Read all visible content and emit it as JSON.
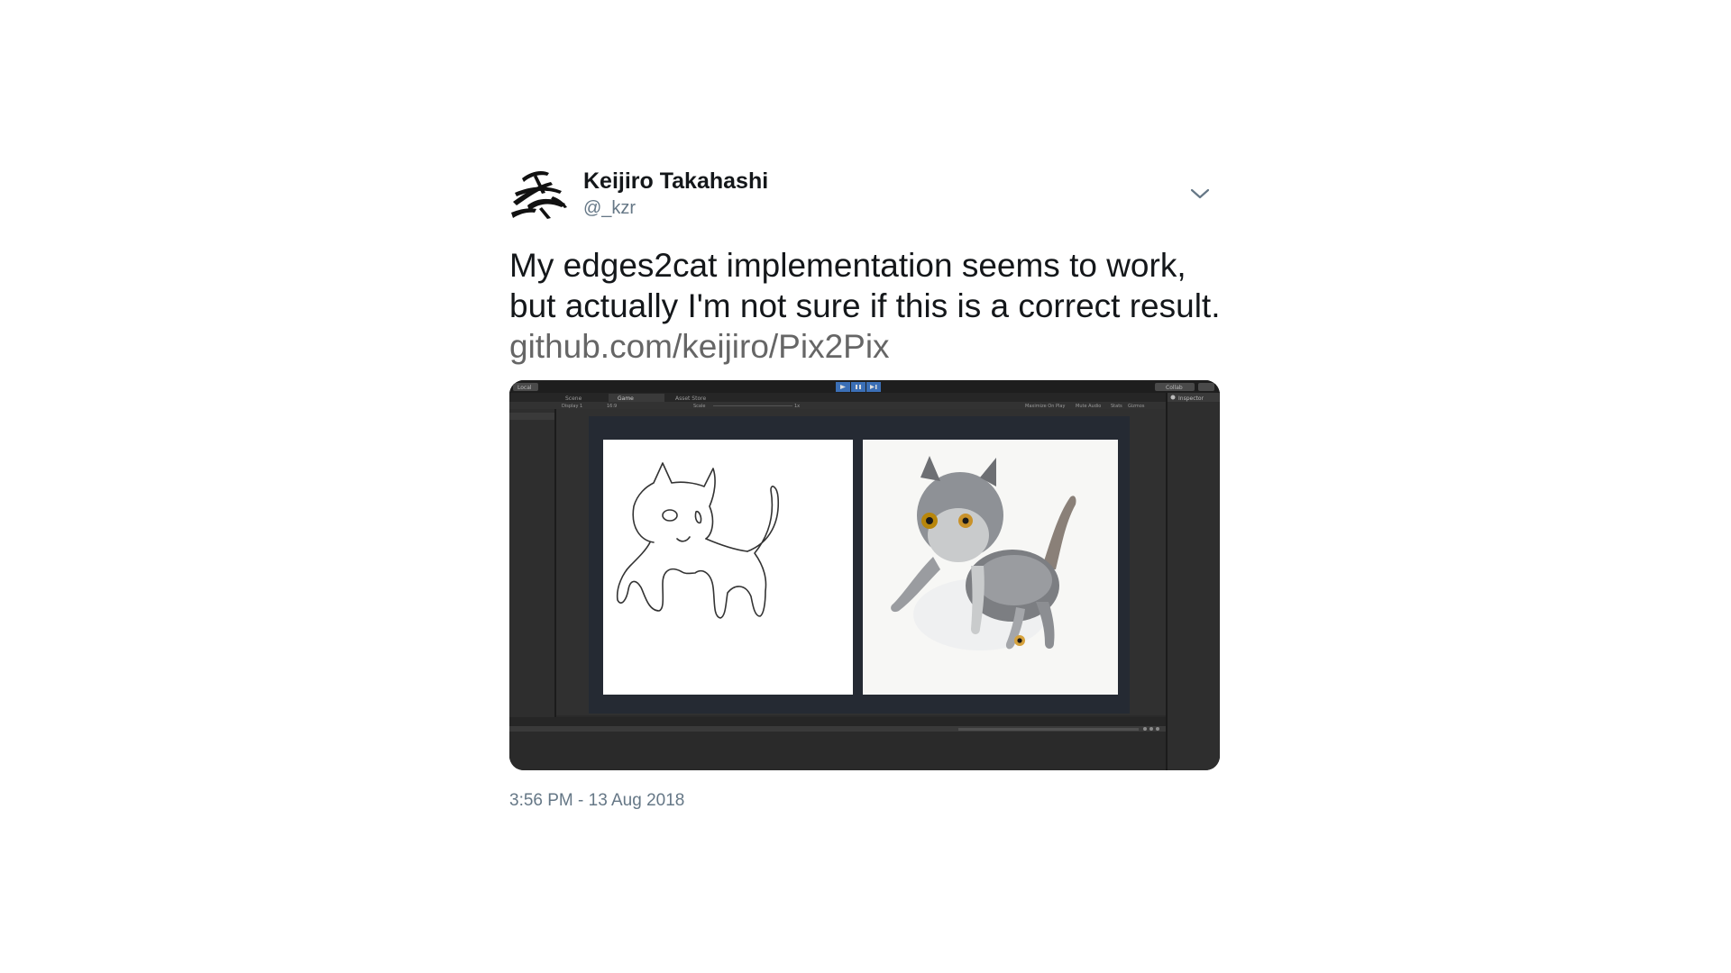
{
  "tweet": {
    "author": {
      "display_name": "Keijiro Takahashi",
      "handle": "@_kzr"
    },
    "text": "My edges2cat implementation seems to work, but actually I'm not sure if this is a correct result. ",
    "link_text": "github.com/keijiro/Pix2Pix",
    "timestamp": "3:56 PM - 13 Aug 2018",
    "menu_icon": "chevron-down-icon"
  },
  "media": {
    "description_icon": "unity-editor-screenshot",
    "editor": {
      "layout_button": "Local",
      "tabs": [
        "Scene",
        "Game",
        "Asset Store"
      ],
      "collab": "Collab",
      "inspector": "Inspector",
      "display": "Display 1",
      "aspect": "16:9",
      "scale_label": "Scale",
      "scale_value": "1x",
      "toolbar_options": [
        "Maximize On Play",
        "Mute Audio",
        "Stats",
        "Gizmos"
      ]
    },
    "colors": {
      "editor_bg": "#2a2a2a",
      "panel": "#383838",
      "game_view_bg": "#252a33",
      "play_button": "#3b6fb6"
    }
  }
}
